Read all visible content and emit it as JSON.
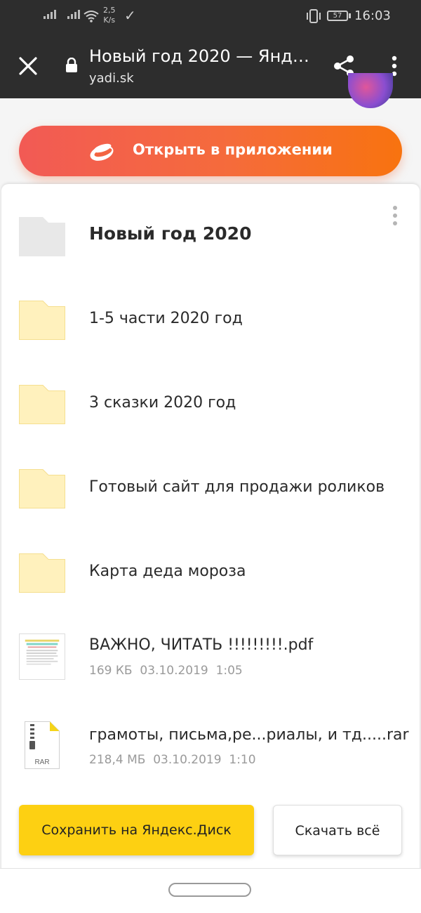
{
  "status_bar": {
    "net_speed_value": "2,5",
    "net_speed_unit": "K/s",
    "battery_level": "57",
    "time": "16:03"
  },
  "toolbar": {
    "title": "Новый год 2020 — Янд…",
    "url": "yadi.sk"
  },
  "open_app_button": {
    "label": "Открыть в приложении",
    "colors": [
      "#f25a55",
      "#f8730f"
    ]
  },
  "folder": {
    "title": "Новый год 2020"
  },
  "items": [
    {
      "name": "1-5 части 2020 год",
      "type": "folder"
    },
    {
      "name": "3 сказки 2020 год",
      "type": "folder"
    },
    {
      "name": "Готовый сайт для продажи роликов",
      "type": "folder"
    },
    {
      "name": "Карта деда мороза",
      "type": "folder"
    },
    {
      "name": "ВАЖНО, ЧИТАТЬ !!!!!!!!!.pdf",
      "type": "pdf",
      "size": "169 КБ",
      "date": "03.10.2019",
      "time": "1:05"
    },
    {
      "name": "грамоты, письма,ре...риалы, и тд.....rar",
      "type": "rar",
      "icon_label": "RAR",
      "size": "218,4 МБ",
      "date": "03.10.2019",
      "time": "1:10"
    }
  ],
  "actions": {
    "save_label": "Сохранить на Яндекс.Диск",
    "download_label": "Скачать всё",
    "save_color": "#fdd012"
  }
}
